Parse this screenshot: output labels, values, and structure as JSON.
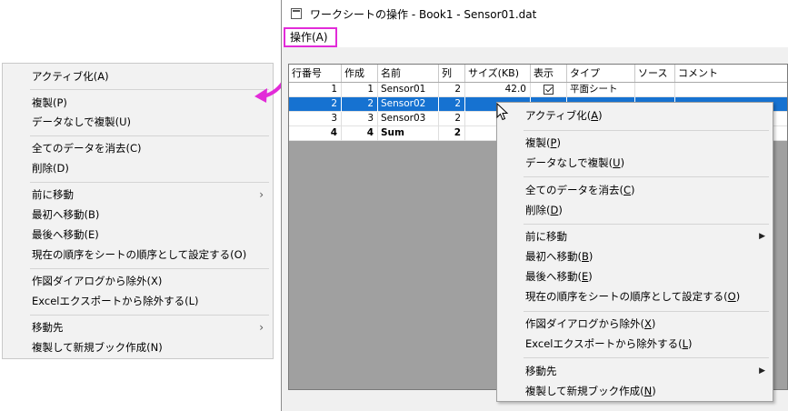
{
  "window": {
    "title": "ワークシートの操作 - Book1 - Sensor01.dat",
    "menu": "操作(A)"
  },
  "columns": [
    "行番号",
    "作成",
    "名前",
    "列",
    "サイズ(KB)",
    "表示",
    "タイプ",
    "ソース",
    "コメント"
  ],
  "rows": [
    {
      "num": "1",
      "created": "1",
      "name": "Sensor01",
      "cols": "2",
      "size": "42.0",
      "type": "平面シート"
    },
    {
      "num": "2",
      "created": "2",
      "name": "Sensor02",
      "cols": "2"
    },
    {
      "num": "3",
      "created": "3",
      "name": "Sensor03",
      "cols": "2"
    },
    {
      "num": "4",
      "created": "4",
      "name": "Sum",
      "cols": "2"
    }
  ],
  "menu_items": [
    {
      "label": "アクティブ化(A)",
      "ul_prefix": "アクティブ化(",
      "ul_char": "A",
      "ul_suffix": ")"
    },
    {
      "label": "複製(P)",
      "ul_prefix": "複製(",
      "ul_char": "P",
      "ul_suffix": ")"
    },
    {
      "label": "データなしで複製(U)",
      "ul_prefix": "データなしで複製(",
      "ul_char": "U",
      "ul_suffix": ")"
    },
    {
      "label": "全てのデータを消去(C)",
      "ul_prefix": "全てのデータを消去(",
      "ul_char": "C",
      "ul_suffix": ")"
    },
    {
      "label": "削除(D)",
      "ul_prefix": "削除(",
      "ul_char": "D",
      "ul_suffix": ")"
    },
    {
      "label": "前に移動",
      "ul_prefix": "前に移動",
      "ul_char": "",
      "ul_suffix": ""
    },
    {
      "label": "最初へ移動(B)",
      "ul_prefix": "最初へ移動(",
      "ul_char": "B",
      "ul_suffix": ")"
    },
    {
      "label": "最後へ移動(E)",
      "ul_prefix": "最後へ移動(",
      "ul_char": "E",
      "ul_suffix": ")"
    },
    {
      "label": "現在の順序をシートの順序として設定する(O)",
      "ul_prefix": "現在の順序をシートの順序として設定する(",
      "ul_char": "O",
      "ul_suffix": ")"
    },
    {
      "label": "作図ダイアログから除外(X)",
      "ul_prefix": "作図ダイアログから除外(",
      "ul_char": "X",
      "ul_suffix": ")"
    },
    {
      "label": "Excelエクスポートから除外する(L)",
      "ul_prefix": "Excelエクスポートから除外する(",
      "ul_char": "L",
      "ul_suffix": ")"
    },
    {
      "label": "移動先",
      "ul_prefix": "移動先",
      "ul_char": "",
      "ul_suffix": ""
    },
    {
      "label": "複製して新規ブック作成(N)",
      "ul_prefix": "複製して新規ブック作成(",
      "ul_char": "N",
      "ul_suffix": ")"
    }
  ],
  "colors": {
    "highlight": "#e22bd8",
    "selection": "#1672d1"
  }
}
